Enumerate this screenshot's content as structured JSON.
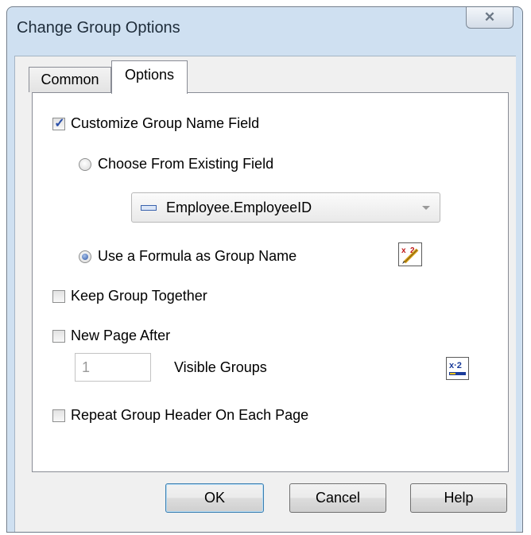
{
  "window": {
    "title": "Change Group Options",
    "close_icon": "close-icon"
  },
  "tabs": [
    {
      "label": "Common"
    },
    {
      "label": "Options",
      "active": true
    }
  ],
  "options": {
    "customize_group_name": {
      "label": "Customize Group Name Field",
      "checked": true
    },
    "choose_existing": {
      "label": "Choose From Existing Field",
      "selected": false
    },
    "field_dropdown": {
      "value": "Employee.EmployeeID"
    },
    "use_formula": {
      "label": "Use a Formula as Group Name",
      "selected": true
    },
    "keep_together": {
      "label": "Keep Group Together",
      "checked": false
    },
    "new_page_after": {
      "label": "New Page After",
      "checked": false
    },
    "visible_groups": {
      "value": "1",
      "label": "Visible Groups"
    },
    "repeat_header": {
      "label": "Repeat Group Header On Each Page",
      "checked": false
    },
    "formula_glyph": "x·2"
  },
  "buttons": {
    "ok": "OK",
    "cancel": "Cancel",
    "help": "Help"
  }
}
